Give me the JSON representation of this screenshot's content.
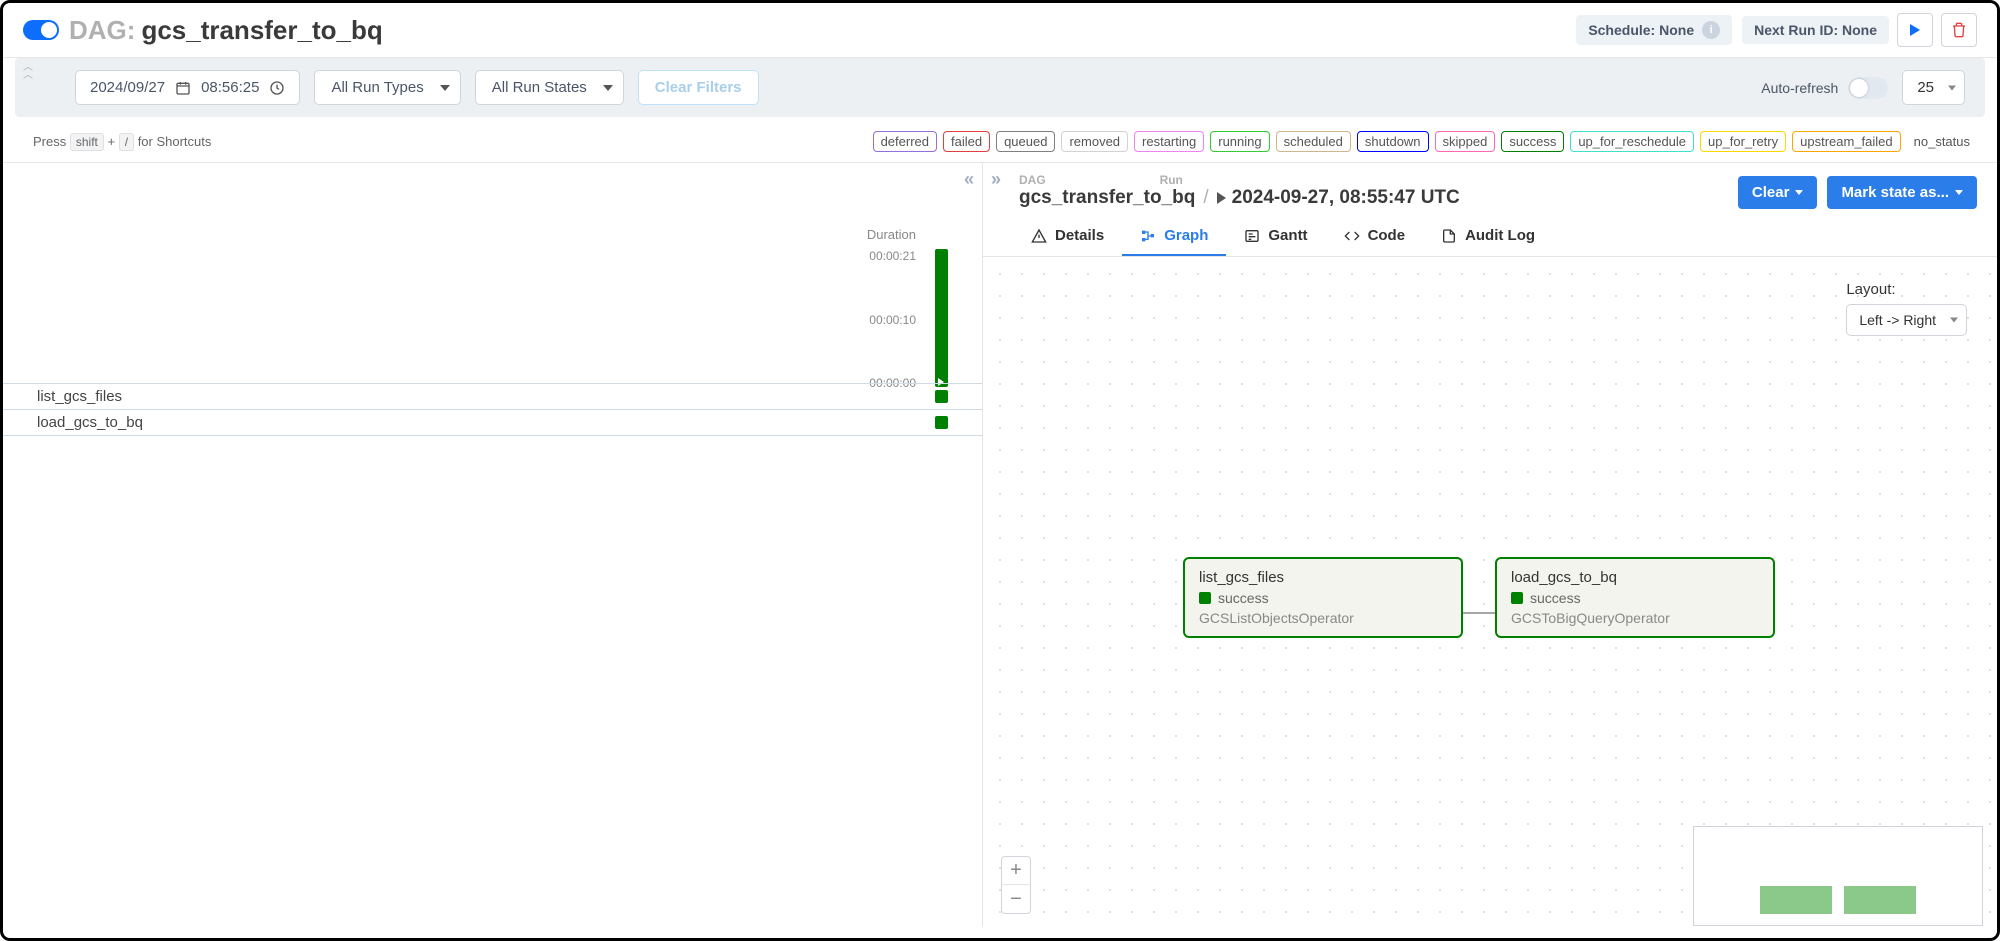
{
  "header": {
    "dag_label": "DAG:",
    "dag_name": "gcs_transfer_to_bq",
    "schedule": "Schedule: None",
    "next_run": "Next Run ID: None"
  },
  "filters": {
    "date": "2024/09/27",
    "time": "08:56:25",
    "run_types": "All Run Types",
    "run_states": "All Run States",
    "clear": "Clear Filters",
    "auto_refresh": "Auto-refresh",
    "page_size": "25"
  },
  "shortcuts": {
    "prefix": "Press",
    "key1": "shift",
    "plus": "+",
    "key2": "/",
    "suffix": "for Shortcuts"
  },
  "legend": {
    "deferred": "deferred",
    "failed": "failed",
    "queued": "queued",
    "removed": "removed",
    "restarting": "restarting",
    "running": "running",
    "scheduled": "scheduled",
    "shutdown": "shutdown",
    "skipped": "skipped",
    "success": "success",
    "up_for_reschedule": "up_for_reschedule",
    "up_for_retry": "up_for_retry",
    "upstream_failed": "upstream_failed",
    "no_status": "no_status"
  },
  "grid": {
    "duration_label": "Duration",
    "ticks": {
      "t1": "00:00:21",
      "t2": "00:00:10",
      "t3": "00:00:00"
    },
    "tasks": {
      "t0": "list_gcs_files",
      "t1": "load_gcs_to_bq"
    }
  },
  "detail": {
    "dag_label": "DAG",
    "run_label": "Run",
    "dag_name": "gcs_transfer_to_bq",
    "run_time": "2024-09-27, 08:55:47 UTC",
    "clear_btn": "Clear",
    "mark_btn": "Mark state as..."
  },
  "tabs": {
    "details": "Details",
    "graph": "Graph",
    "gantt": "Gantt",
    "code": "Code",
    "audit": "Audit Log"
  },
  "graph": {
    "layout_label": "Layout:",
    "layout_value": "Left -> Right",
    "nodes": {
      "n0": {
        "title": "list_gcs_files",
        "status": "success",
        "op": "GCSListObjectsOperator"
      },
      "n1": {
        "title": "load_gcs_to_bq",
        "status": "success",
        "op": "GCSToBigQueryOperator"
      }
    }
  }
}
